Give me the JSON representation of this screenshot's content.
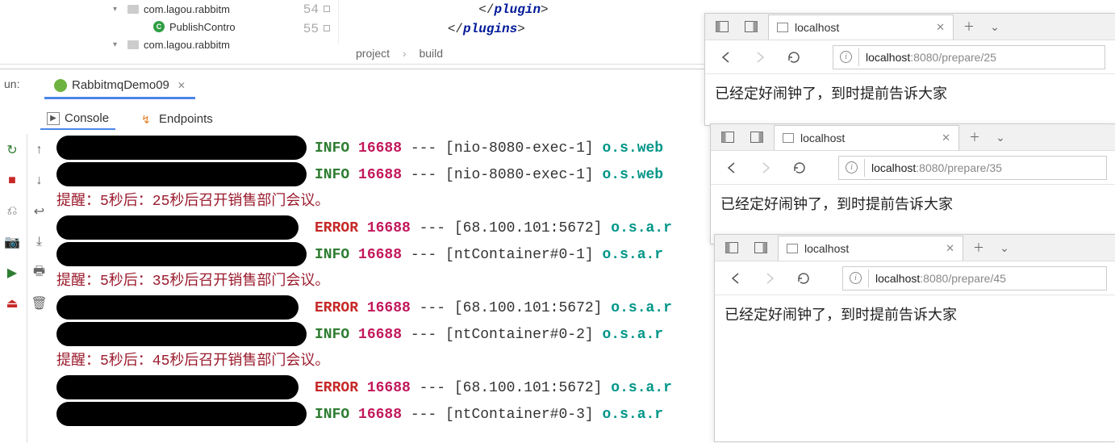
{
  "projectTree": {
    "pkg1": "com.lagou.rabbitm",
    "classFile": "PublishContro",
    "pkg2": "com.lagou.rabbitm"
  },
  "editor": {
    "line54_no": "54",
    "line55_no": "55",
    "tag_plugin_close": "plugin",
    "tag_plugins_close": "plugins"
  },
  "breadcrumb": {
    "a": "project",
    "b": "build"
  },
  "run": {
    "label": "un:",
    "tabName": "RabbitmqDemo09",
    "console": "Console",
    "endpoints": "Endpoints"
  },
  "consoleLines": [
    {
      "type": "log",
      "level": "INFO",
      "pid": "16688",
      "dash": "---",
      "thread": "[nio-8080-exec-1]",
      "pkg": "o.s.web"
    },
    {
      "type": "log",
      "level": "INFO",
      "pid": "16688",
      "dash": "---",
      "thread": "[nio-8080-exec-1]",
      "pkg": "o.s.web"
    },
    {
      "type": "reminder",
      "text": "提醒：5秒后：25秒后召开销售部门会议。"
    },
    {
      "type": "log",
      "level": "ERROR",
      "pid": "16688",
      "dash": "---",
      "thread": "[68.100.101:5672]",
      "pkg": "o.s.a.r"
    },
    {
      "type": "log",
      "level": "INFO",
      "pid": "16688",
      "dash": "---",
      "thread": "[ntContainer#0-1]",
      "pkg": "o.s.a.r"
    },
    {
      "type": "reminder",
      "text": "提醒：5秒后：35秒后召开销售部门会议。"
    },
    {
      "type": "log",
      "level": "ERROR",
      "pid": "16688",
      "dash": "---",
      "thread": "[68.100.101:5672]",
      "pkg": "o.s.a.r"
    },
    {
      "type": "log",
      "level": "INFO",
      "pid": "16688",
      "dash": "---",
      "thread": "[ntContainer#0-2]",
      "pkg": "o.s.a.r"
    },
    {
      "type": "reminder",
      "text": "提醒：5秒后：45秒后召开销售部门会议。"
    },
    {
      "type": "log",
      "level": "ERROR",
      "pid": "16688",
      "dash": "---",
      "thread": "[68.100.101:5672]",
      "pkg": "o.s.a.r"
    },
    {
      "type": "log",
      "level": "INFO",
      "pid": "16688",
      "dash": "---",
      "thread": "[ntContainer#0-3]",
      "pkg": "o.s.a.r"
    }
  ],
  "browsers": [
    {
      "tabTitle": "localhost",
      "urlHost": "localhost",
      "urlPort": ":8080",
      "urlPath": "/prepare/25",
      "content": "已经定好闹钟了，到时提前告诉大家"
    },
    {
      "tabTitle": "localhost",
      "urlHost": "localhost",
      "urlPort": ":8080",
      "urlPath": "/prepare/35",
      "content": "已经定好闹钟了，到时提前告诉大家"
    },
    {
      "tabTitle": "localhost",
      "urlHost": "localhost",
      "urlPort": ":8080",
      "urlPath": "/prepare/45",
      "content": "已经定好闹钟了，到时提前告诉大家"
    }
  ]
}
